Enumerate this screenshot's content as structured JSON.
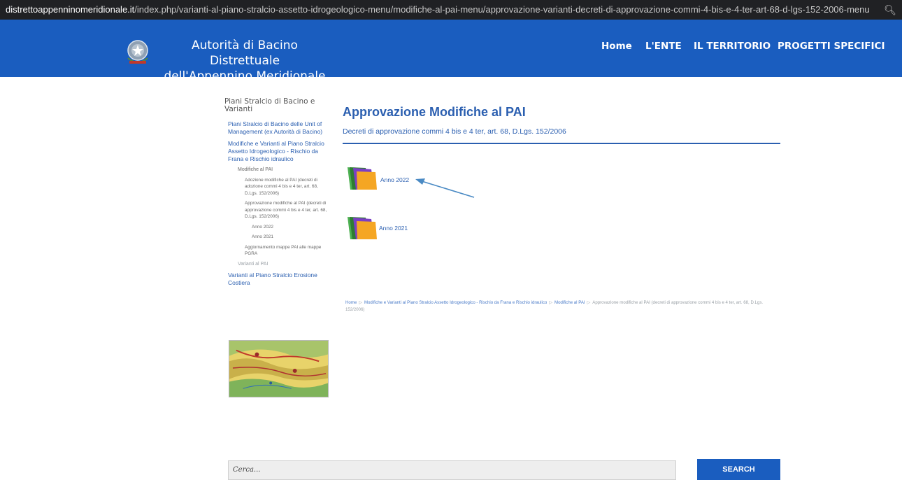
{
  "browser": {
    "url_host": "distrettoappenninomeridionale.it",
    "url_path": "/index.php/varianti-al-piano-stralcio-assetto-idrogeologico-menu/modifiche-al-pai-menu/approvazione-varianti-decreti-di-approvazione-commi-4-bis-e-4-ter-art-68-d-lgs-152-2006-menu",
    "zoom_icon": "magnifier-icon"
  },
  "header": {
    "title_line1": "Autorità di Bacino Distrettuale",
    "title_line2": "dell'Appennino Meridionale",
    "nav": [
      "Home",
      "L'ENTE",
      "IL TERRITORIO",
      "PROGETTI SPECIFICI"
    ],
    "background_color": "#1a5dbf"
  },
  "sidebar": {
    "title": "Piani Stralcio di Bacino e Varianti",
    "items": [
      "Piani Stralcio di Bacino delle Unit of Management (ex Autorità di Bacino)",
      "Modifiche e Varianti al Piano Stralcio Assetto Idrogeologico - Rischio da Frana e Rischio idraulico",
      "Modifiche al PAI",
      "Adozione modifiche al PAI (decreti di adozione commi 4 bis e 4 ter, art. 68, D.Lgs. 152/2006)",
      "Approvazione modifiche al PAI (decreti di approvazione commi 4 bis e 4 ter, art. 68, D.Lgs. 152/2006)",
      "Anno 2022",
      "Anno 2021",
      "Aggiornamento mappe PAI alle mappe PGRA",
      "Varianti al PAI",
      "Varianti al Piano Stralcio Erosione Costiera"
    ]
  },
  "main": {
    "title": "Approvazione Modifiche al PAI",
    "subtitle": "Decreti di approvazione commi 4 bis e 4 ter, art. 68, D.Lgs. 152/2006",
    "folders": [
      {
        "label": "Anno 2022",
        "icon": "folder-icon"
      },
      {
        "label": "Anno 2021",
        "icon": "folder-icon"
      }
    ],
    "accent_color": "#2b5fb0"
  },
  "breadcrumb": {
    "items": [
      "Home",
      "Modifiche e Varianti al Piano Stralcio Assetto Idrogeologico - Rischio da Frana e Rischio idraulico",
      "Modifiche al PAI",
      "Approvazione modifiche al PAI (decreti di approvazione commi 4 bis e 4 ter, art. 68, D.Lgs. 152/2006)"
    ],
    "separator": "▷"
  },
  "search": {
    "placeholder": "Cerca...",
    "button_label": "SEARCH"
  }
}
